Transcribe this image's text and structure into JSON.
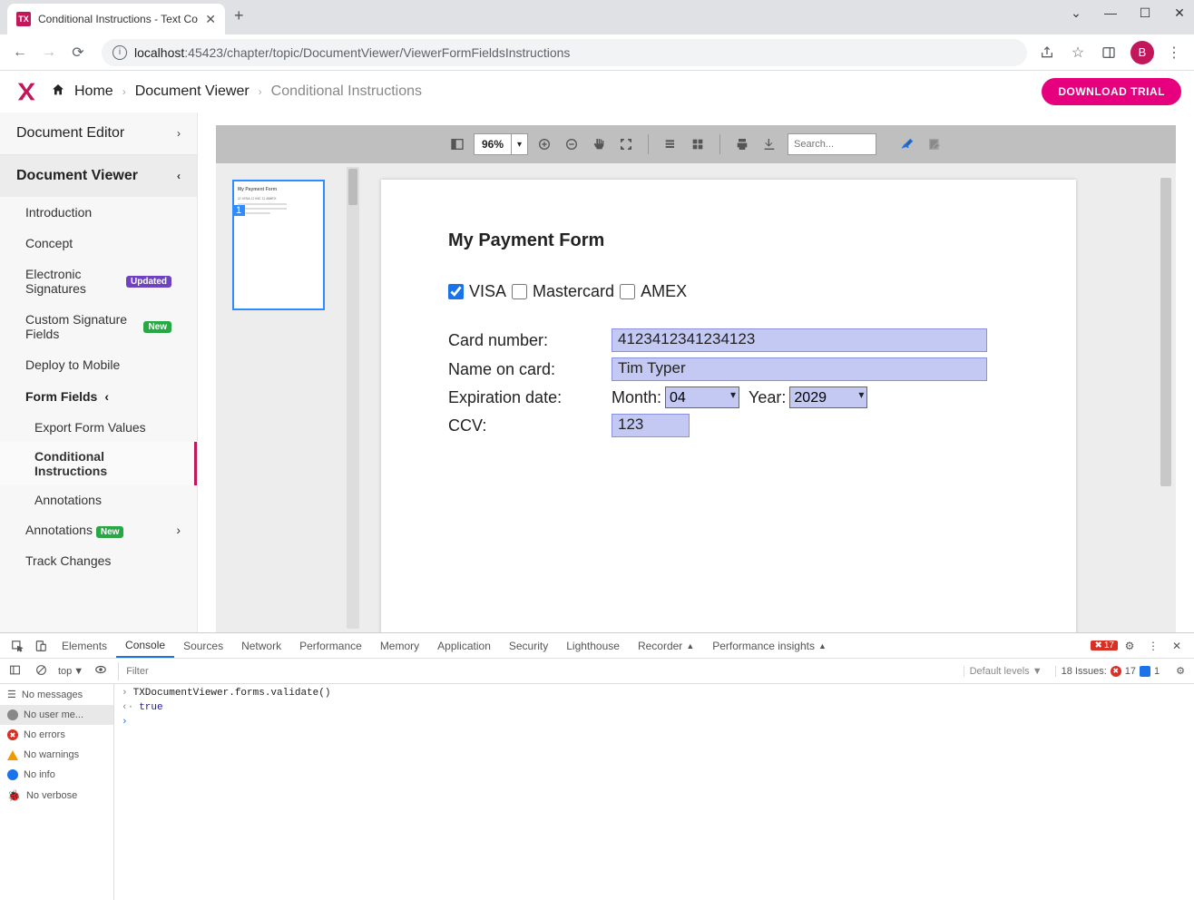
{
  "browser": {
    "tab_title": "Conditional Instructions - Text Co",
    "favicon_text": "TX",
    "url_host": "localhost",
    "url_port": ":45423",
    "url_path": "/chapter/topic/DocumentViewer/ViewerFormFieldsInstructions",
    "avatar_letter": "B"
  },
  "header": {
    "breadcrumbs": {
      "home": "Home",
      "l1": "Document Viewer",
      "l2": "Conditional Instructions"
    },
    "download": "DOWNLOAD TRIAL"
  },
  "sidebar": {
    "doc_editor": "Document Editor",
    "doc_viewer": "Document Viewer",
    "items": {
      "intro": "Introduction",
      "concept": "Concept",
      "esig": "Electronic Signatures",
      "esig_badge": "Updated",
      "csf": "Custom Signature Fields",
      "csf_badge": "New",
      "deploy": "Deploy to Mobile",
      "form_fields": "Form Fields",
      "export_fv": "Export Form Values",
      "cond_instr": "Conditional Instructions",
      "annotations_sub": "Annotations",
      "annotations": "Annotations",
      "annotations_badge": "New",
      "track_changes": "Track Changes"
    }
  },
  "toolbar": {
    "zoom": "96%",
    "search_placeholder": "Search..."
  },
  "thumbnail": {
    "page_num": "1"
  },
  "document": {
    "title": "My Payment Form",
    "cards": {
      "visa": "VISA",
      "mastercard": "Mastercard",
      "amex": "AMEX"
    },
    "labels": {
      "card_number": "Card number:",
      "name_on_card": "Name on card:",
      "expiration": "Expiration date:",
      "month": "Month:",
      "year": "Year:",
      "ccv": "CCV:"
    },
    "values": {
      "card_number": "4123412341234123",
      "name_on_card": "Tim Typer",
      "month": "04",
      "year": "2029",
      "ccv": "123"
    }
  },
  "devtools": {
    "tabs": {
      "elements": "Elements",
      "console": "Console",
      "sources": "Sources",
      "network": "Network",
      "performance": "Performance",
      "memory": "Memory",
      "application": "Application",
      "security": "Security",
      "lighthouse": "Lighthouse",
      "recorder": "Recorder",
      "perf_insights": "Performance insights"
    },
    "error_count": "17",
    "filter": {
      "context": "top",
      "placeholder": "Filter",
      "levels": "Default levels",
      "issues_label": "18 Issues:",
      "issues_err": "17",
      "issues_msg": "1"
    },
    "sidebar": {
      "no_messages": "No messages",
      "no_user": "No user me...",
      "no_errors": "No errors",
      "no_warnings": "No warnings",
      "no_info": "No info",
      "no_verbose": "No verbose"
    },
    "console_lines": {
      "cmd": "TXDocumentViewer.forms.validate()",
      "result": "true"
    }
  }
}
